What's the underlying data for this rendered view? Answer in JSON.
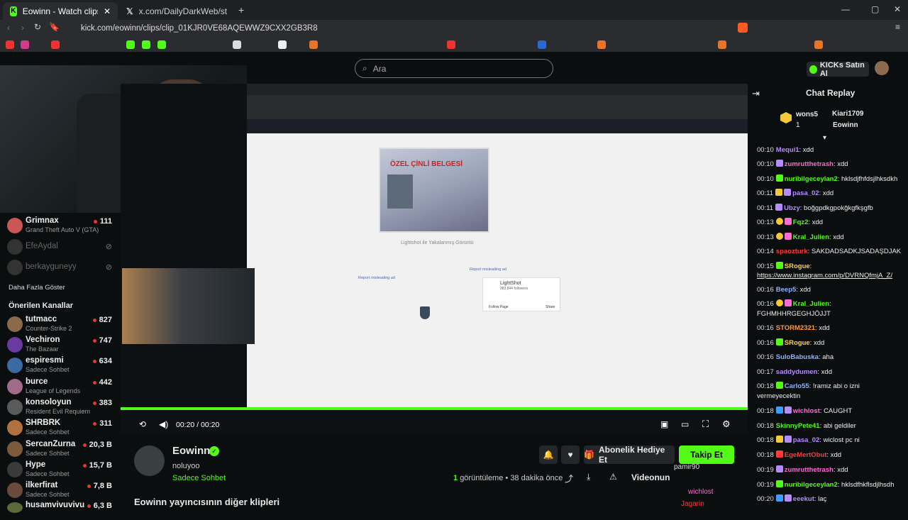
{
  "browser": {
    "tabs": [
      {
        "title": "Eowinn - Watch clips on Kick",
        "active": true
      },
      {
        "title": "x.com/DailyDarkWeb/status/2028446",
        "active": false
      }
    ],
    "url": "kick.com/eowinn/clips/clip_01KJR0VE68AQEWWZ9CXX2GB3R8"
  },
  "header": {
    "search_placeholder": "Ara",
    "kicks_label": "KICKs Satın Al"
  },
  "sidebar": {
    "followed": [
      {
        "name": "Grimnax",
        "category": "Grand Theft Auto V (GTA)",
        "viewers": "111",
        "color": "#c55"
      },
      {
        "name": "EfeAydal",
        "category": "",
        "viewers": "",
        "color": "#444"
      },
      {
        "name": "berkayguneyy",
        "category": "",
        "viewers": "",
        "color": "#444"
      }
    ],
    "show_more": "Daha Fazla Göster",
    "recommended_title": "Önerilen Kanallar",
    "recommended": [
      {
        "name": "tutmacc",
        "category": "Counter-Strike 2",
        "viewers": "827",
        "color": "#8a6a4a"
      },
      {
        "name": "Vechiron",
        "category": "The Bazaar",
        "viewers": "747",
        "color": "#6a3aa0"
      },
      {
        "name": "espiresmi",
        "category": "Sadece Sohbet",
        "viewers": "634",
        "color": "#3a6aa0"
      },
      {
        "name": "burce",
        "category": "League of Legends",
        "viewers": "442",
        "color": "#a06a8a"
      },
      {
        "name": "konsoloyun",
        "category": "Resident Evil Requiem",
        "viewers": "383",
        "color": "#5a5a5a"
      },
      {
        "name": "SHRBRK",
        "category": "Sadece Sohbet",
        "viewers": "311",
        "color": "#b07040"
      },
      {
        "name": "SercanZurna",
        "category": "Sadece Sohbet",
        "viewers": "20,3 B",
        "color": "#7a5a3a"
      },
      {
        "name": "Hype",
        "category": "Sadece Sohbet",
        "viewers": "15,7 B",
        "color": "#3a3a3a"
      },
      {
        "name": "ilkerfirat",
        "category": "Sadece Sohbet",
        "viewers": "7,8 B",
        "color": "#6a4a3a"
      },
      {
        "name": "husamvivuvivu",
        "category": "",
        "viewers": "6,3 B",
        "color": "#5a6a3a"
      }
    ]
  },
  "video": {
    "time": "00:20 / 00:20",
    "inner_id_title": "ÖZEL ÇİNLİ BELGESİ",
    "inner_caption": "Lightshot ile Yakalanmış Görüntü",
    "inner_report": "Report misleading ad",
    "inner_ls_name": "LightShot",
    "inner_ls_followers": "383,844 followers",
    "inner_follow_page": "Follow Page",
    "inner_share": "Share"
  },
  "clip": {
    "streamer": "Eowinn",
    "title": "noluyoo",
    "category": "Sadece Sohbet",
    "views_count": "1",
    "views_label": "görüntüleme",
    "time_ago": "38 dakika önce",
    "subgift_label": "Abonelik Hediye Et",
    "follow_label": "Takip Et",
    "report_label": "Videonun",
    "more_clips": "Eowinn yayıncısının diğer klipleri"
  },
  "chat": {
    "title": "Chat Replay",
    "top": [
      {
        "name": "wons5",
        "count": "1"
      },
      {
        "name": "Kiari1709",
        "count": "1"
      },
      {
        "name": "Eowinn",
        "count": ""
      }
    ],
    "messages": [
      {
        "time": "00:10",
        "user": "Mequi1",
        "color": "#b58cff",
        "text": ": xdd"
      },
      {
        "time": "00:10",
        "user": "zumrutthetrash",
        "color": "#ff6ad5",
        "text": ": xdd"
      },
      {
        "time": "00:10",
        "user": "nuribilgeceylan2",
        "color": "#53fc18",
        "text": ": hklsdjfhfdsjlhksdkh"
      },
      {
        "time": "00:11",
        "user": "pasa_02",
        "color": "#b58cff",
        "text": ": xdd"
      },
      {
        "time": "00:11",
        "user": "Ubzy",
        "color": "#b58cff",
        "text": ": boğgpdkgpokğkgfkşgfb"
      },
      {
        "time": "00:13",
        "user": "Fqz2",
        "color": "#53fc18",
        "text": ": xdd"
      },
      {
        "time": "00:13",
        "user": "Kral_Julien",
        "color": "#53fc18",
        "text": ": xdd"
      },
      {
        "time": "00:14",
        "user": "spaozturk",
        "color": "#ff3b3b",
        "text": ": SAKDADSADKJSADAŞDJAK"
      },
      {
        "time": "00:15",
        "user": "SRogue",
        "color": "#ffd23f",
        "text": ":"
      },
      {
        "time": "",
        "user": "",
        "color": "#eee",
        "text": "https://www.instagram.com/p/DVRNQfmjA_Z/"
      },
      {
        "time": "00:16",
        "user": "Beep5",
        "color": "#8ab4ff",
        "text": ": xdd"
      },
      {
        "time": "00:16",
        "user": "Kral_Julien",
        "color": "#53fc18",
        "text": ":"
      },
      {
        "time": "",
        "user": "",
        "color": "#eee",
        "text": "FGHMHHRGEGHJÖJJT"
      },
      {
        "time": "00:16",
        "user": "STORM2321",
        "color": "#ff9a3c",
        "text": ": xdd"
      },
      {
        "time": "00:16",
        "user": "SRogue",
        "color": "#ffd23f",
        "text": ": xdd"
      },
      {
        "time": "00:16",
        "user": "SuloBabuska",
        "color": "#8ab4ff",
        "text": ": aha"
      },
      {
        "time": "00:17",
        "user": "saddydumen",
        "color": "#b58cff",
        "text": ": xdd"
      },
      {
        "time": "00:18",
        "user": "Carlo55",
        "color": "#8ab4ff",
        "text": ": !ramiz abi o izni"
      },
      {
        "time": "",
        "user": "",
        "color": "#eee",
        "text": "vermeyecektin"
      },
      {
        "time": "00:18",
        "user": "wichlost",
        "color": "#ff6ad5",
        "text": ": CAUGHT"
      },
      {
        "time": "00:18",
        "user": "SkinnyPete41",
        "color": "#53fc18",
        "text": ": abi geldiler"
      },
      {
        "time": "00:18",
        "user": "pasa_02",
        "color": "#b58cff",
        "text": ": wiclost pc ni"
      },
      {
        "time": "00:18",
        "user": "EgeMertObut",
        "color": "#ff3b3b",
        "text": ": xdd"
      },
      {
        "time": "00:19",
        "user": "zumrutthetrash",
        "color": "#ff6ad5",
        "text": ": xdd"
      },
      {
        "time": "00:19",
        "user": "nuribilgeceylan2",
        "color": "#53fc18",
        "text": ": hklsdfhkflsdjlhsdh"
      },
      {
        "time": "00:20",
        "user": "eeekut",
        "color": "#b58cff",
        "text": ": laç"
      }
    ],
    "overlay": [
      {
        "user": "pamir90",
        "color": "#ddd"
      },
      {
        "user": "wichlost",
        "color": "#ff6ad5"
      },
      {
        "user": "Jagarin",
        "color": "#ff3b3b"
      }
    ]
  }
}
